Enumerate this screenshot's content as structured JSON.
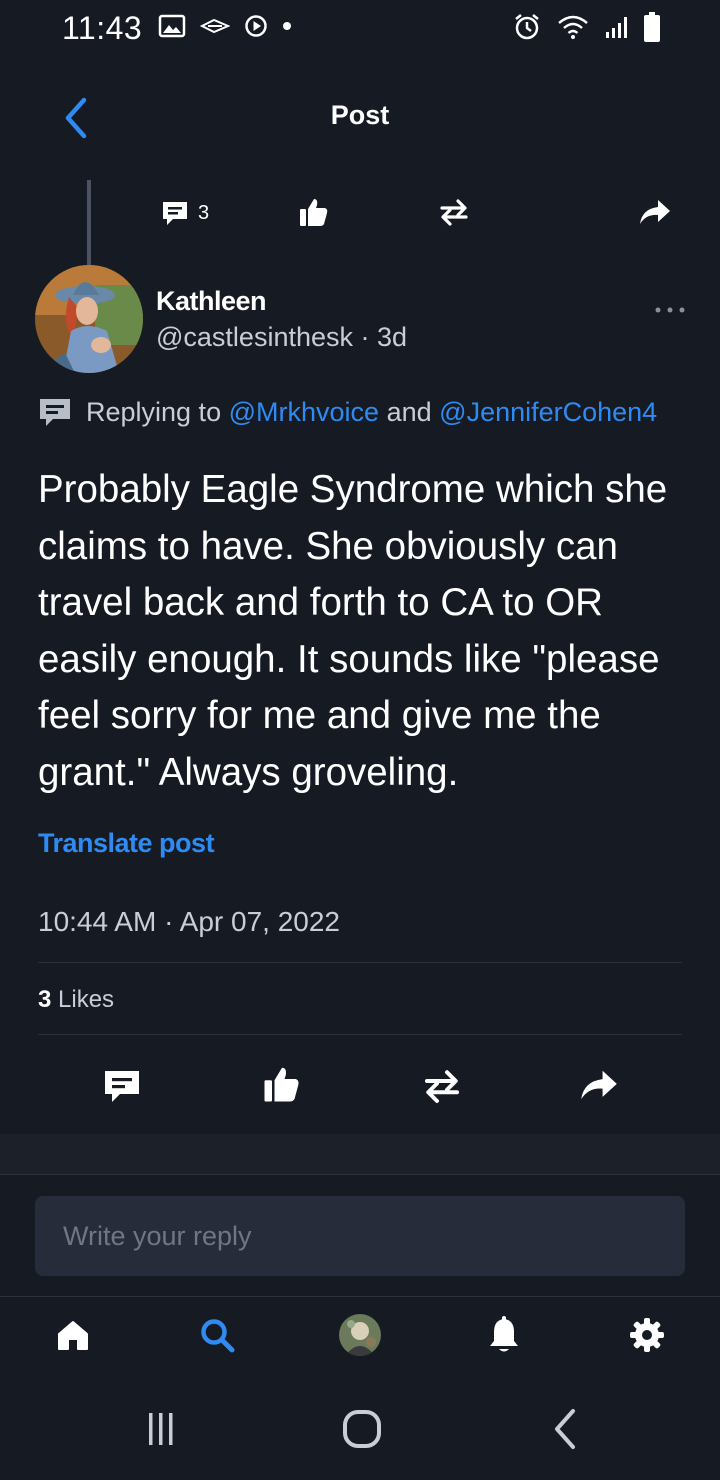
{
  "status_bar": {
    "time": "11:43",
    "left_icons": [
      "gallery-icon",
      "sync-icon",
      "media-icon",
      "dot-icon"
    ],
    "right_icons": [
      "alarm-icon",
      "wifi-icon",
      "signal-icon",
      "battery-icon"
    ]
  },
  "header": {
    "title": "Post",
    "back_icon": "chevron-left-icon"
  },
  "parent_actions": {
    "reply_count": "3",
    "icons": [
      "comment-icon",
      "thumbs-up-icon",
      "repost-icon",
      "share-icon"
    ]
  },
  "author": {
    "name": "Kathleen",
    "handle": "@castlesinthesk",
    "age": "3d",
    "separator": " · "
  },
  "replying": {
    "prefix": "Replying to",
    "mention1": "@Mrkhvoice",
    "conjunction": "and",
    "mention2": "@JenniferCohen4"
  },
  "post": {
    "body": "Probably Eagle Syndrome which she claims to have. She obviously can travel back and forth to CA to OR easily enough. It sounds like \"please feel sorry for me and give me the grant.\" Always groveling.",
    "translate_label": "Translate post",
    "timestamp": "10:44 AM · Apr 07, 2022",
    "likes_count": "3",
    "likes_label": "Likes"
  },
  "reply_box": {
    "placeholder": "Write your reply"
  },
  "tabbar": {
    "items": [
      "home-icon",
      "search-icon",
      "profile-avatar",
      "bell-icon",
      "gear-icon"
    ],
    "active": "search-icon"
  },
  "system_nav": [
    "recents-icon",
    "home-circle-icon",
    "back-chevron-icon"
  ],
  "colors": {
    "background": "#151a23",
    "accent": "#2f8bf1",
    "muted_text": "#c9ced6",
    "input_bg": "#262c39"
  }
}
